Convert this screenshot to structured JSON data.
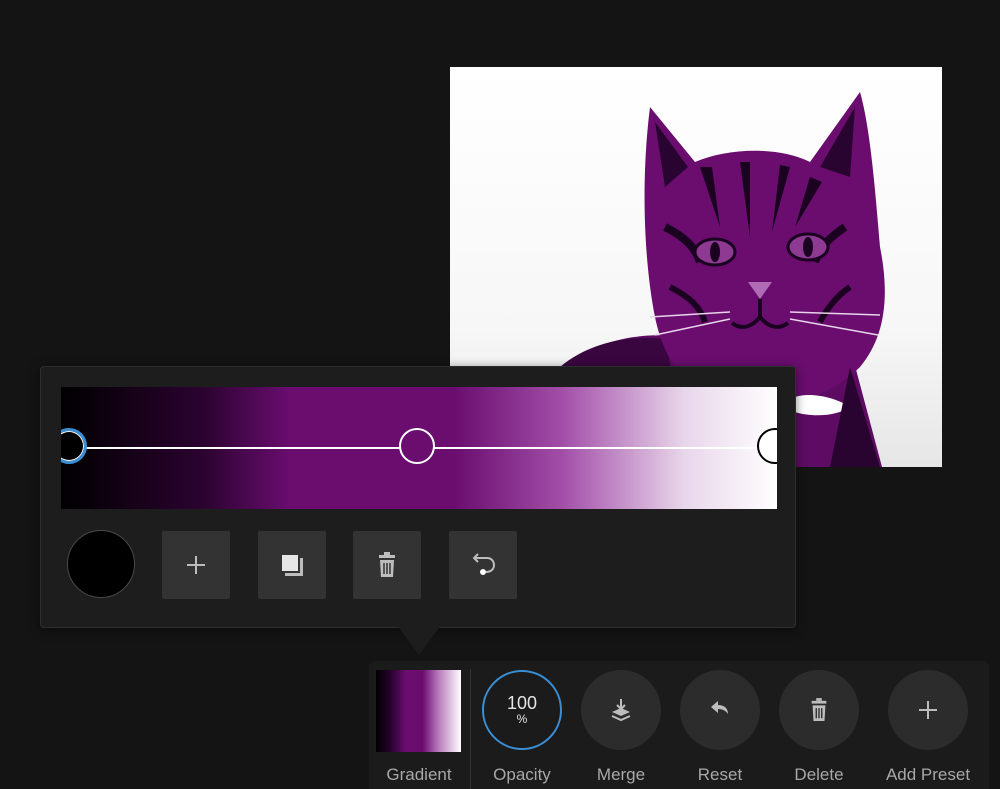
{
  "canvas": {
    "image_subject": "cat",
    "colors": {
      "shadow": "#000000",
      "midtone": "#6a0d6f",
      "highlight": "#ffffff"
    }
  },
  "gradient_editor": {
    "stops": [
      {
        "position": 0.0,
        "color": "#000000",
        "selected": true
      },
      {
        "position": 0.5,
        "color": "#6a0d6f",
        "selected": false
      },
      {
        "position": 1.0,
        "color": "#ffffff",
        "selected": false
      }
    ],
    "current_color": "#000000",
    "tools": [
      {
        "name": "add-stop",
        "icon": "plus-icon"
      },
      {
        "name": "duplicate-stop",
        "icon": "duplicate-icon"
      },
      {
        "name": "delete-stop",
        "icon": "trash-icon"
      },
      {
        "name": "reverse",
        "icon": "reverse-icon"
      }
    ]
  },
  "toolbar": {
    "gradient_label": "Gradient",
    "opacity_value": "100",
    "opacity_unit": "%",
    "opacity_label": "Opacity",
    "merge_label": "Merge",
    "reset_label": "Reset",
    "delete_label": "Delete",
    "add_preset_label": "Add Preset"
  },
  "accent_color": "#3a8fd4"
}
